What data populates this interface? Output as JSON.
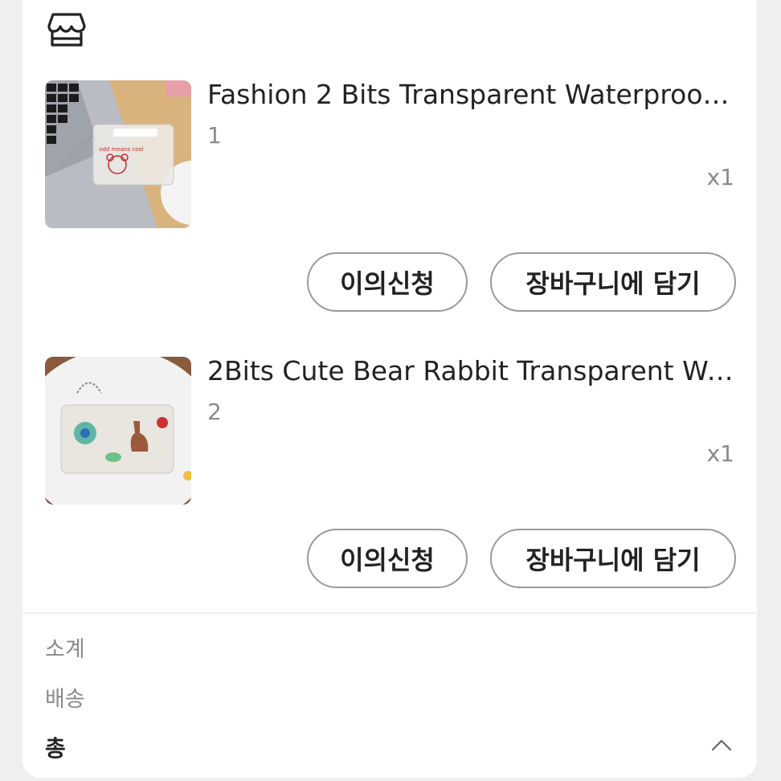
{
  "items": [
    {
      "title": "Fashion 2 Bits Transparent Waterproof ...",
      "option": "1",
      "qty": "x1",
      "thumb_text": "odd means cool",
      "buttons": {
        "dispute": "이의신청",
        "cart": "장바구니에 담기"
      }
    },
    {
      "title": "2Bits Cute Bear Rabbit Transparent Wat...",
      "option": "2",
      "qty": "x1",
      "buttons": {
        "dispute": "이의신청",
        "cart": "장바구니에 담기"
      }
    }
  ],
  "summary": {
    "subtotal_label": "소계",
    "shipping_label": "배송",
    "total_label": "총"
  },
  "icons": {
    "store": "store-icon",
    "expand": "chevron-up-icon"
  },
  "colors": {
    "background": "#efefef",
    "card": "#ffffff",
    "button_border": "#9a9a9a",
    "muted_text": "#8a8a8a"
  }
}
